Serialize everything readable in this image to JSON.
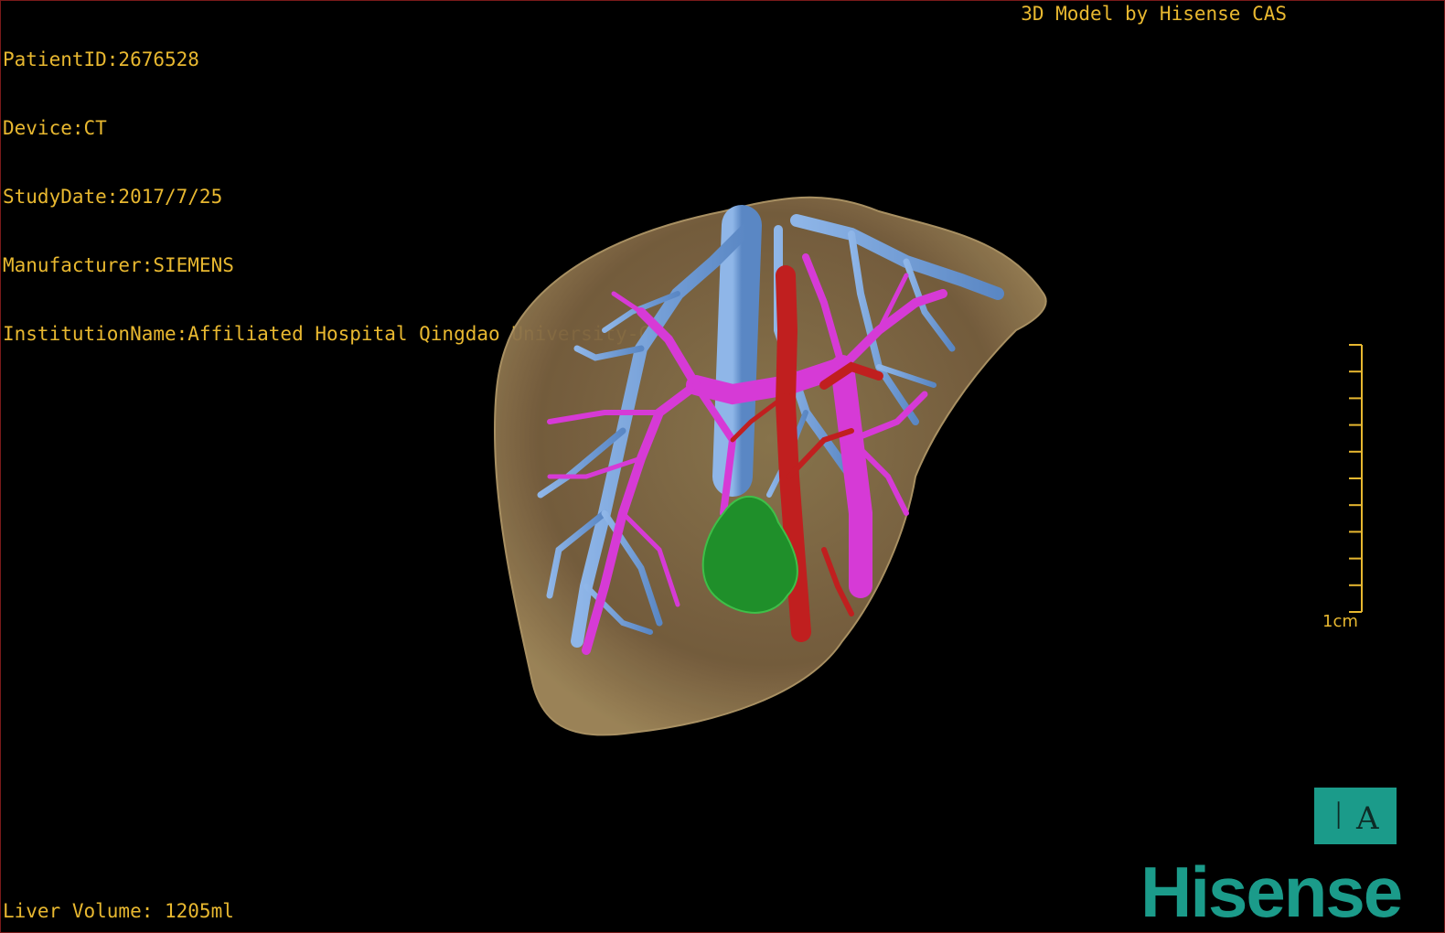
{
  "patient_info": {
    "patient_id": "PatientID:2676528",
    "device": "Device:CT",
    "study_date": "StudyDate:2017/7/25",
    "manufacturer": "Manufacturer:SIEMENS",
    "institution": "InstitutionName:Affiliated Hospital Qingdao University-C"
  },
  "model_credit": "3D Model by Hisense CAS",
  "liver_volume": "Liver Volume: 1205ml",
  "scale": {
    "label": "1cm",
    "tick_count": 10
  },
  "orientation_cube": {
    "face_label": "꒐A"
  },
  "brand": "Hisense",
  "colors": {
    "text": "#e8b830",
    "liver": "#8a7047",
    "hepatic_vein": "#6f9fd8",
    "portal_vein": "#d63ad6",
    "artery": "#c01f1f",
    "lesion": "#1f8f2a",
    "brand": "#1b9b8a"
  }
}
